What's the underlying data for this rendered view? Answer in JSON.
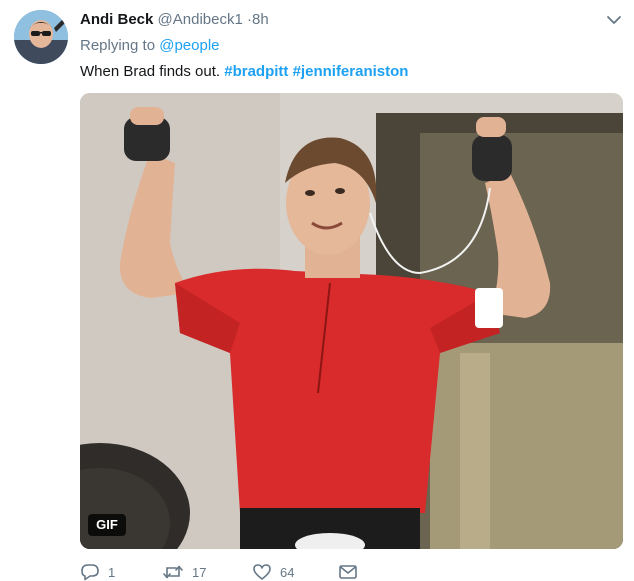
{
  "tweet": {
    "display_name": "Andi Beck",
    "handle": "@Andibeck1",
    "separator": "·",
    "timestamp": "8h",
    "reply_prefix": "Replying to",
    "reply_mention": "@people",
    "text": "When Brad finds out.",
    "hashtags": [
      "#bradpitt",
      "#jenniferaniston"
    ],
    "media_badge": "GIF"
  },
  "actions": {
    "reply_count": "1",
    "retweet_count": "17",
    "like_count": "64"
  },
  "icons": {
    "menu": "chevron-down-icon",
    "reply": "reply-icon",
    "retweet": "retweet-icon",
    "like": "heart-icon",
    "dm": "envelope-icon"
  },
  "colors": {
    "link": "#1da1f2",
    "secondary_text": "#657786",
    "primary_text": "#14171a"
  }
}
